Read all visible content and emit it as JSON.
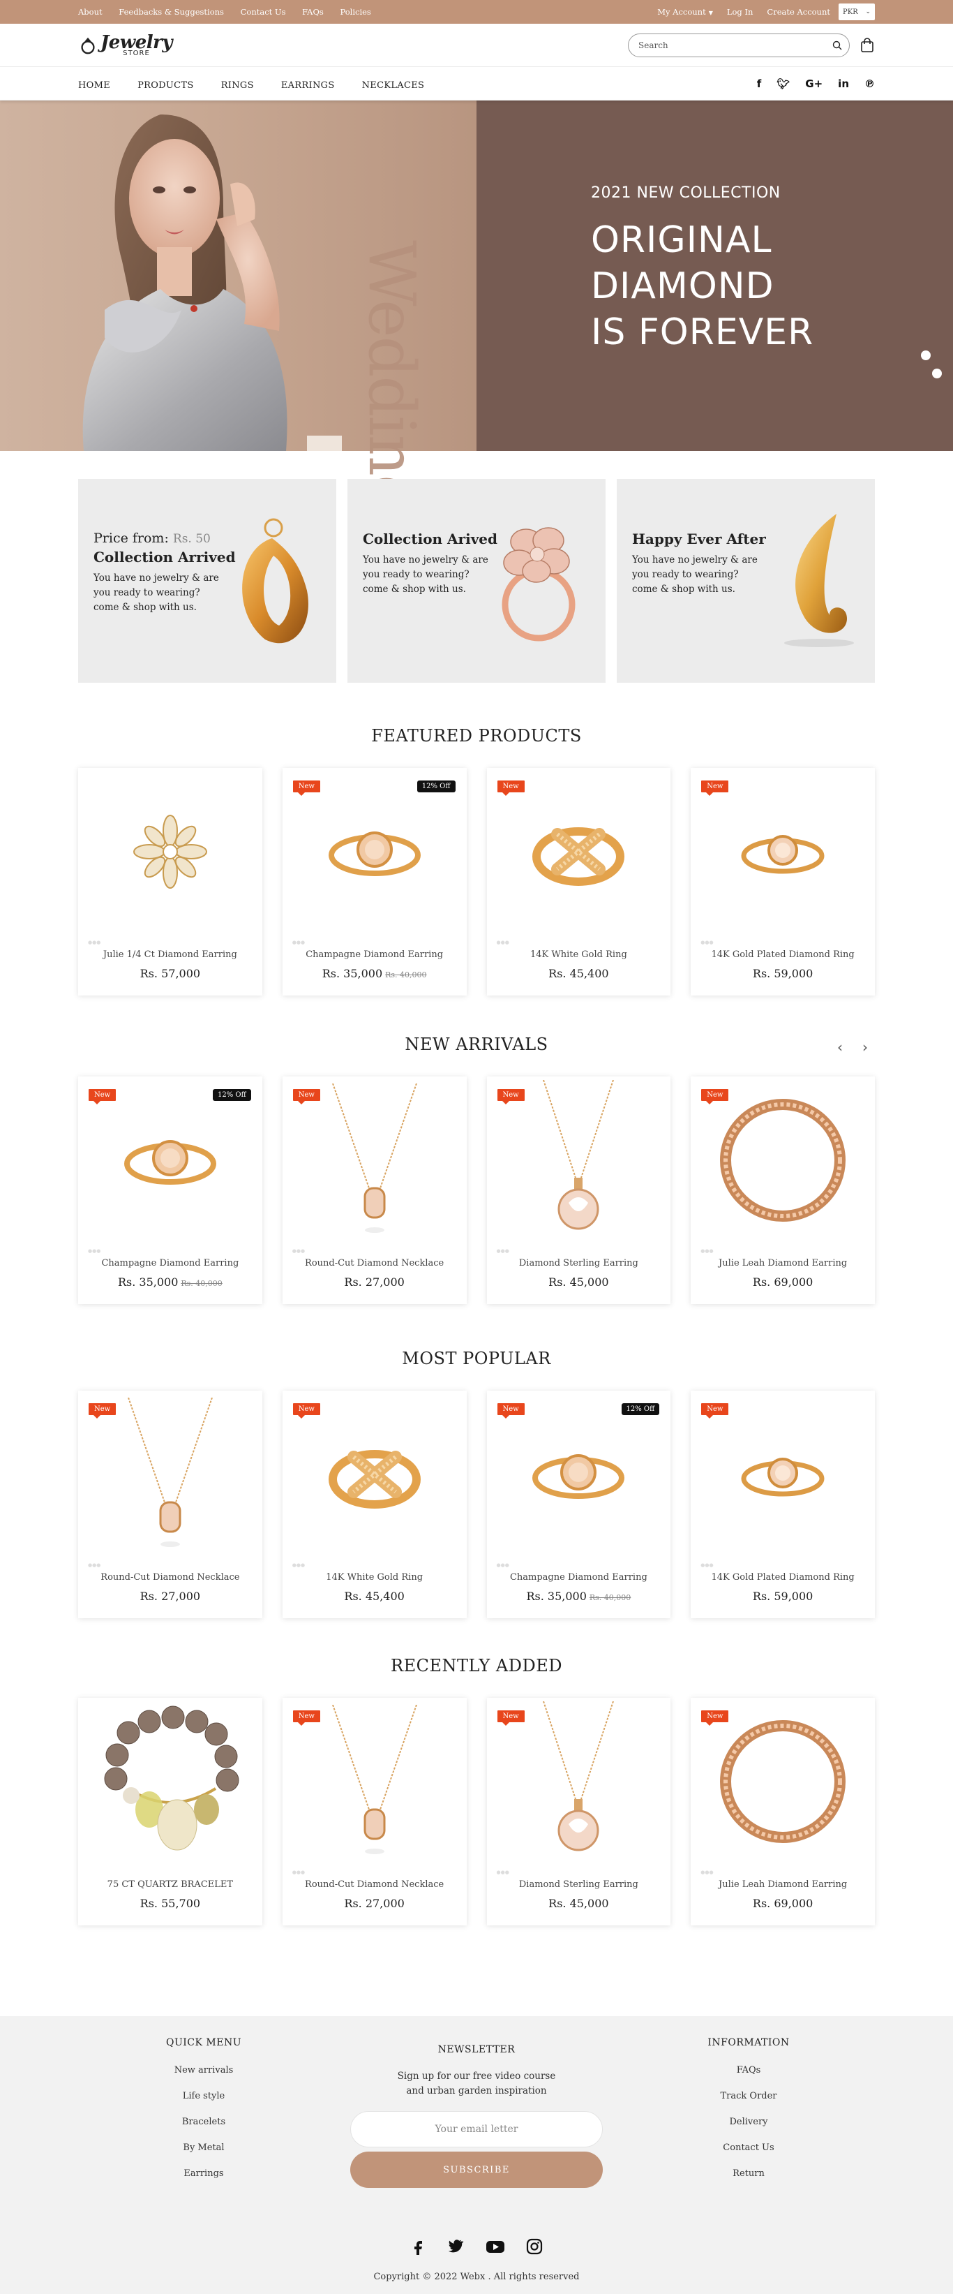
{
  "topbar": {
    "links": [
      "About",
      "Feedbacks & Suggestions",
      "Contact Us",
      "FAQs",
      "Policies"
    ],
    "my_account": "My Account",
    "login": "Log In",
    "create_account": "Create Account",
    "currency": "PKR"
  },
  "header": {
    "logo_main": "Jewelry",
    "logo_sub": "STORE",
    "search_placeholder": "Search"
  },
  "nav": {
    "items": [
      "HOME",
      "PRODUCTS",
      "RINGS",
      "EARRINGS",
      "NECKLACES"
    ],
    "social_icons": [
      "facebook-icon",
      "twitter-icon",
      "google-plus-icon",
      "linkedin-icon",
      "pinterest-icon"
    ]
  },
  "hero": {
    "watermark": "Wedding",
    "kicker": "2021 NEW COLLECTION",
    "title_lines": [
      "ORIGINAL",
      "DIAMOND",
      "IS FOREVER"
    ]
  },
  "promos": [
    {
      "price_label": "Price from:",
      "price_value": "Rs. 50",
      "title": "Collection Arrived",
      "text": "You have no jewelry & are you ready to wearing? come & shop with us."
    },
    {
      "title": "Collection Arived",
      "text": "You have no jewelry & are you ready to wearing? come & shop with us."
    },
    {
      "title": "Happy Ever After",
      "text": "You have no jewelry & are you ready to wearing? come & shop with us."
    }
  ],
  "sections": {
    "featured": {
      "title": "FEATURED PRODUCTS",
      "products": [
        {
          "name": "Julie 1/4 Ct Diamond Earring",
          "price": "Rs. 57,000",
          "old_price": "",
          "new": "",
          "off": ""
        },
        {
          "name": "Champagne Diamond Earring",
          "price": "Rs. 35,000",
          "old_price": "Rs. 40,000",
          "new": "New",
          "off": "12% Off"
        },
        {
          "name": "14K White Gold Ring",
          "price": "Rs. 45,400",
          "old_price": "",
          "new": "New",
          "off": ""
        },
        {
          "name": "14K Gold Plated Diamond Ring",
          "price": "Rs. 59,000",
          "old_price": "",
          "new": "New",
          "off": ""
        }
      ]
    },
    "arrivals": {
      "title": "NEW ARRIVALS",
      "products": [
        {
          "name": "Champagne Diamond Earring",
          "price": "Rs. 35,000",
          "old_price": "Rs. 40,000",
          "new": "New",
          "off": "12% Off"
        },
        {
          "name": "Round-Cut Diamond Necklace",
          "price": "Rs. 27,000",
          "old_price": "",
          "new": "New",
          "off": ""
        },
        {
          "name": "Diamond Sterling Earring",
          "price": "Rs. 45,000",
          "old_price": "",
          "new": "New",
          "off": ""
        },
        {
          "name": "Julie Leah Diamond Earring",
          "price": "Rs. 69,000",
          "old_price": "",
          "new": "New",
          "off": ""
        }
      ]
    },
    "popular": {
      "title": "MOST POPULAR",
      "products": [
        {
          "name": "Round-Cut Diamond Necklace",
          "price": "Rs. 27,000",
          "old_price": "",
          "new": "New",
          "off": ""
        },
        {
          "name": "14K White Gold Ring",
          "price": "Rs. 45,400",
          "old_price": "",
          "new": "New",
          "off": ""
        },
        {
          "name": "Champagne Diamond Earring",
          "price": "Rs. 35,000",
          "old_price": "Rs. 40,000",
          "new": "New",
          "off": "12% Off"
        },
        {
          "name": "14K Gold Plated Diamond Ring",
          "price": "Rs. 59,000",
          "old_price": "",
          "new": "New",
          "off": ""
        }
      ]
    },
    "recent": {
      "title": "RECENTLY ADDED",
      "products": [
        {
          "name": "75 CT QUARTZ BRACELET",
          "price": "Rs. 55,700",
          "old_price": "",
          "new": "",
          "off": ""
        },
        {
          "name": "Round-Cut Diamond Necklace",
          "price": "Rs. 27,000",
          "old_price": "",
          "new": "New",
          "off": ""
        },
        {
          "name": "Diamond Sterling Earring",
          "price": "Rs. 45,000",
          "old_price": "",
          "new": "New",
          "off": ""
        },
        {
          "name": "Julie Leah Diamond Earring",
          "price": "Rs. 69,000",
          "old_price": "",
          "new": "New",
          "off": ""
        }
      ]
    }
  },
  "footer": {
    "quick_menu": {
      "title": "QUICK MENU",
      "items": [
        "New arrivals",
        "Life style",
        "Bracelets",
        "By Metal",
        "Earrings"
      ]
    },
    "newsletter": {
      "title": "NEWSLETTER",
      "text": "Sign up for our free video course and urban garden inspiration",
      "placeholder": "Your email letter",
      "button": "SUBSCRIBE"
    },
    "information": {
      "title": "INFORMATION",
      "items": [
        "FAQs",
        "Track Order",
        "Delivery",
        "Contact Us",
        "Return"
      ]
    },
    "social_icons": [
      "facebook-icon",
      "twitter-icon",
      "youtube-icon",
      "instagram-icon"
    ],
    "copyright": "Copyright © 2022 Webx . All rights reserved"
  },
  "colors": {
    "accent": "#c19479",
    "hero_dark": "#765b52",
    "badge_new": "#e8461c",
    "badge_off": "#111111"
  }
}
